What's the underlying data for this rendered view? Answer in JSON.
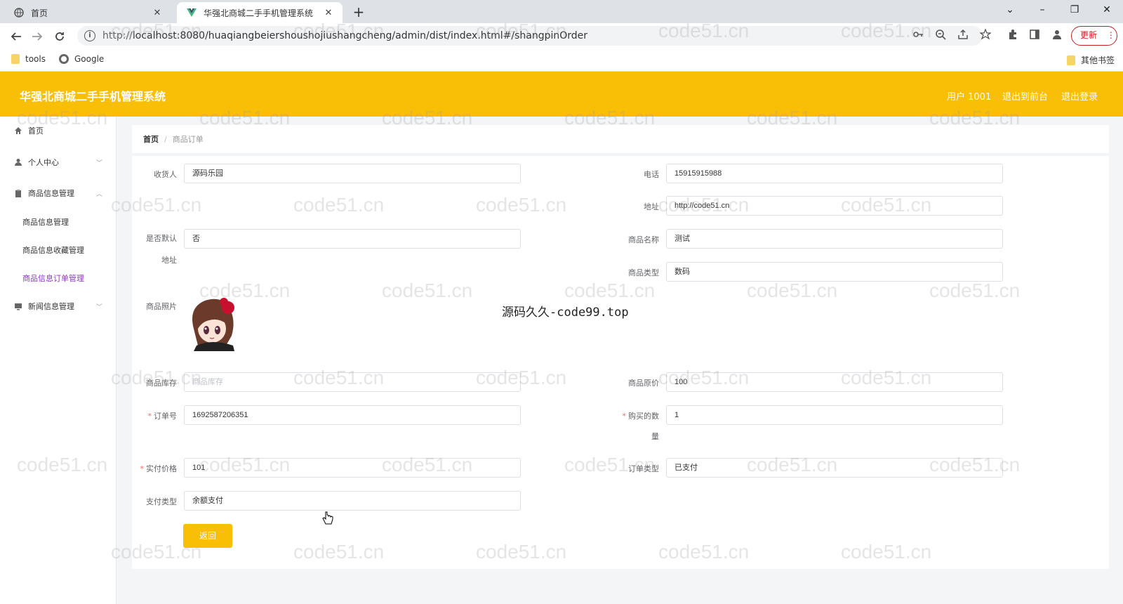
{
  "browser": {
    "tabs": [
      {
        "title": "首页",
        "close": "✕"
      },
      {
        "title": "华强北商城二手手机管理系统",
        "close": "✕"
      }
    ],
    "newtab": "+",
    "window_controls": {
      "dropdown": "⌄",
      "minimize": "–",
      "restore": "❐",
      "close": "✕"
    },
    "url_proto": "http://",
    "url_rest": "localhost:8080/huaqiangbeiershoushojiushangcheng/admin/dist/index.html#/shangpinOrder",
    "update_label": "更新",
    "bookmarks": [
      {
        "label": "tools"
      },
      {
        "label": "Google"
      }
    ],
    "other_bookmarks": "其他书签"
  },
  "header": {
    "title": "华强北商城二手手机管理系统",
    "user": "用户 1001",
    "back_front": "退出到前台",
    "logout": "退出登录",
    "color": "#f9be06"
  },
  "sidebar": {
    "home": "首页",
    "personal": "个人中心",
    "goods_mgmt": "商品信息管理",
    "sub": [
      "商品信息管理",
      "商品信息收藏管理",
      "商品信息订单管理"
    ],
    "news": "新闻信息管理",
    "active_color": "#8a3ab9"
  },
  "breadcrumb": {
    "home": "首页",
    "sep": "/",
    "current": "商品订单"
  },
  "form": {
    "consignee_label": "收货人",
    "consignee": "源码乐园",
    "phone_label": "电话",
    "phone": "15915915988",
    "address_label": "地址",
    "address": "http://code51.cn",
    "default_label_1": "是否默认",
    "default_label_2": "地址",
    "default": "否",
    "goods_name_label": "商品名称",
    "goods_name": "测试",
    "goods_type_label": "商品类型",
    "goods_type": "数码",
    "photo_label": "商品照片",
    "stock_label": "商品库存",
    "stock_placeholder": "商品库存",
    "orig_price_label": "商品原价",
    "orig_price": "100",
    "order_no_label": "订单号",
    "order_no": "1692587206351",
    "qty_label_1": "购买的数",
    "qty_label_2": "量",
    "qty": "1",
    "paid_label": "实付价格",
    "paid": "101",
    "order_type_label": "订单类型",
    "order_type": "已支付",
    "pay_type_label": "支付类型",
    "pay_type": "余额支付",
    "required_mark": "*",
    "back_button": "返回"
  },
  "overlay": "源码久久-code99.top",
  "watermark": "code51.cn"
}
